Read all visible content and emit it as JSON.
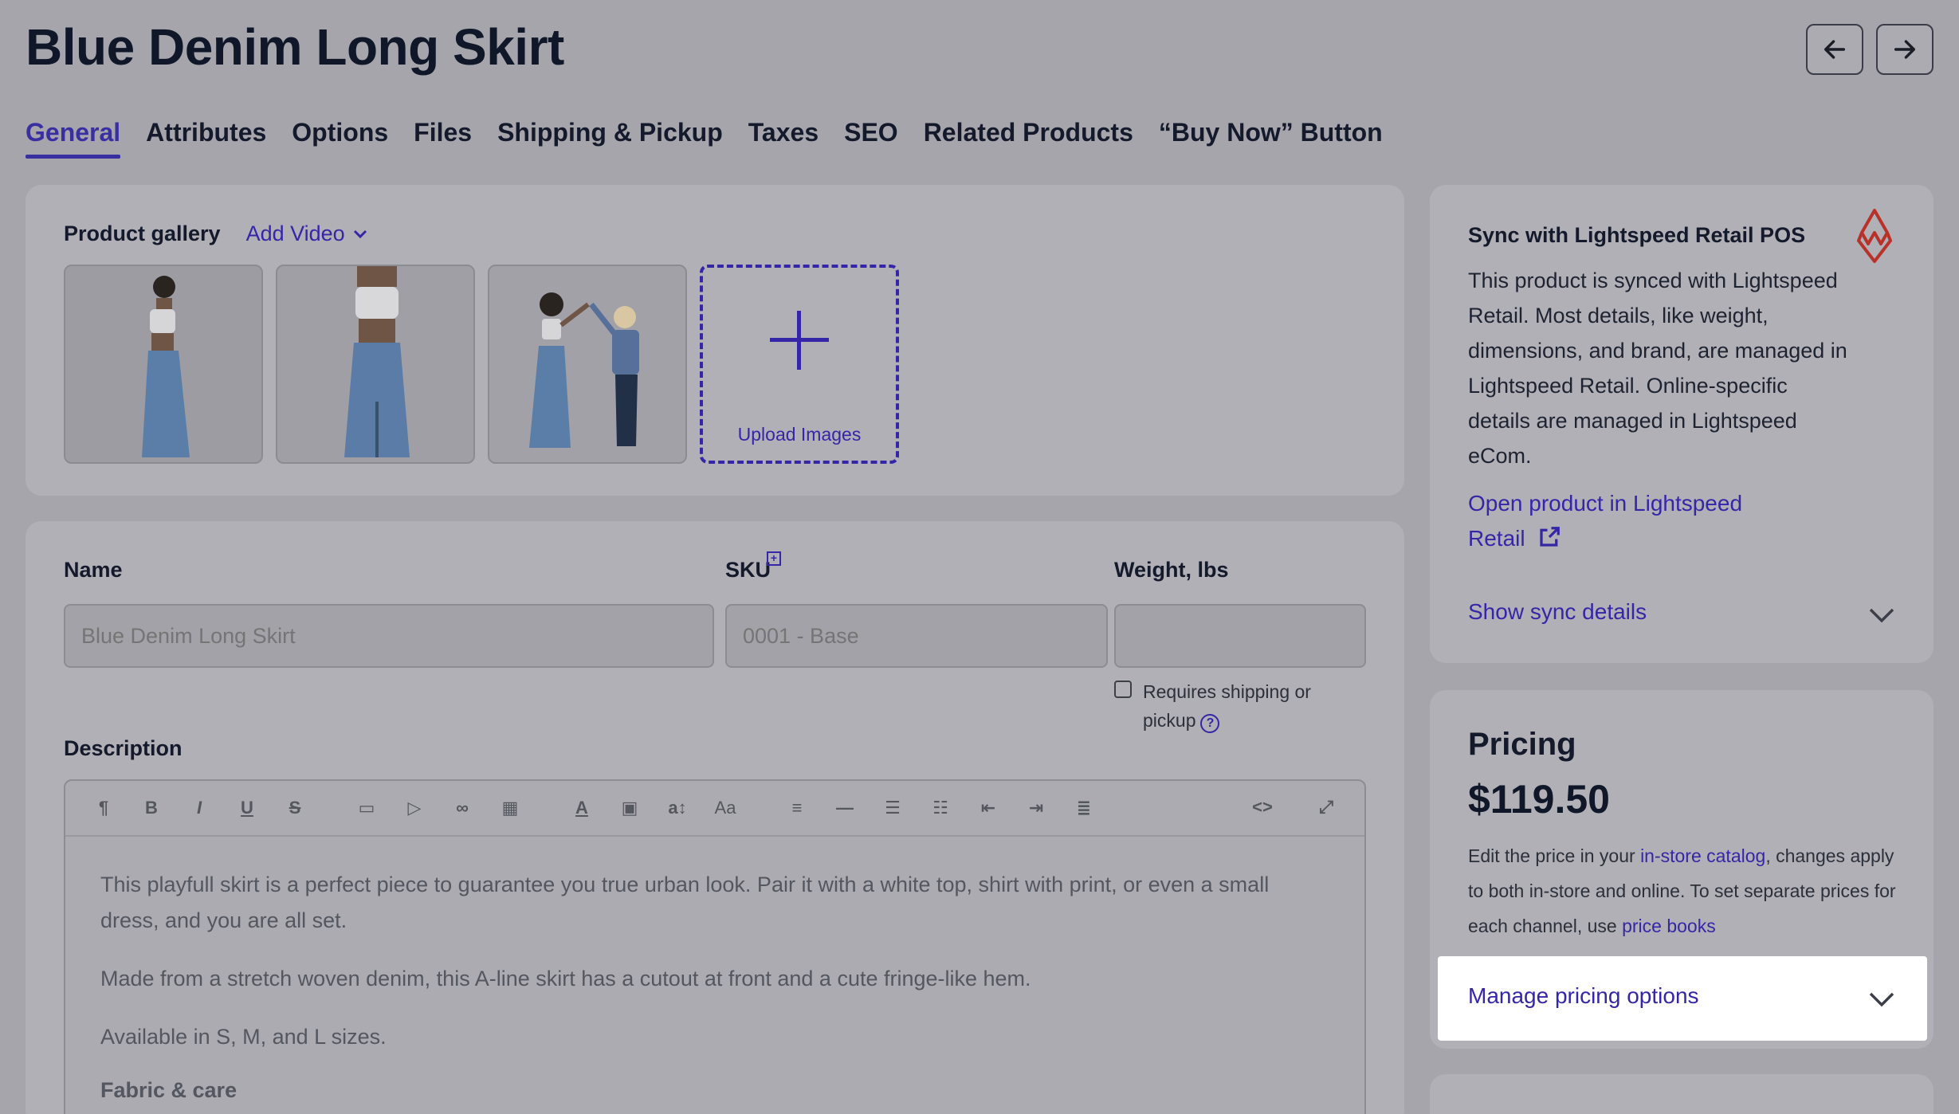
{
  "header": {
    "title": "Blue Denim Long Skirt",
    "prev_icon": "arrow-left-icon",
    "next_icon": "arrow-right-icon"
  },
  "tabs": [
    {
      "label": "General",
      "active": true
    },
    {
      "label": "Attributes"
    },
    {
      "label": "Options"
    },
    {
      "label": "Files"
    },
    {
      "label": "Shipping & Pickup"
    },
    {
      "label": "Taxes"
    },
    {
      "label": "SEO"
    },
    {
      "label": "Related Products"
    },
    {
      "label": "“Buy Now” Button"
    }
  ],
  "gallery": {
    "title": "Product gallery",
    "add_video": "Add Video",
    "upload_label": "Upload Images"
  },
  "form": {
    "name_label": "Name",
    "name_placeholder": "Blue Denim Long Skirt",
    "sku_label": "SKU",
    "sku_placeholder": "0001 - Base",
    "weight_label": "Weight, lbs",
    "weight_value": "",
    "requires_shipping_label": "Requires shipping or pickup",
    "requires_shipping_checked": false,
    "description_label": "Description",
    "description": {
      "p1": "This playfull skirt is a perfect piece to guarantee you true urban look. Pair it with a white top, shirt with print, or even a small dress, and you are all set.",
      "p2": "Made from a stretch woven denim, this A-line skirt has a cutout at front and a cute fringe-like hem.",
      "p3": "Available in S, M, and L sizes.",
      "h1": "Fabric & care"
    }
  },
  "sync": {
    "title": "Sync with Lightspeed Retail POS",
    "body": "This product is synced with Lightspeed Retail. Most details, like weight, dimensions, and brand, are managed in Lightspeed Retail. Online-specific details are managed in Lightspeed eCom.",
    "open_link": "Open product in Lightspeed Retail",
    "show_details": "Show sync details"
  },
  "pricing": {
    "title": "Pricing",
    "price": "$119.50",
    "note_before": "Edit the price in your ",
    "note_link1": "in-store catalog",
    "note_mid": ", changes apply to both in-store and online. To set separate prices for each channel, use ",
    "note_link2": "price books",
    "manage_label": "Manage pricing options"
  },
  "colors": {
    "accent": "#3526a8",
    "overlay": "#a6a5ac",
    "card": "#b1b0b6",
    "lightspeed_red": "#c0392b"
  }
}
